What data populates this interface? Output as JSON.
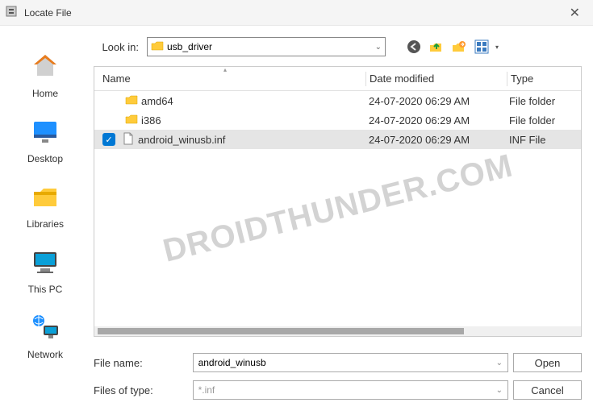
{
  "titlebar": {
    "title": "Locate File"
  },
  "lookin": {
    "label": "Look in:",
    "value": "usb_driver"
  },
  "sidebar": [
    {
      "label": "Home"
    },
    {
      "label": "Desktop"
    },
    {
      "label": "Libraries"
    },
    {
      "label": "This PC"
    },
    {
      "label": "Network"
    }
  ],
  "columns": {
    "name": "Name",
    "date": "Date modified",
    "type": "Type"
  },
  "rows": [
    {
      "name": "amd64",
      "date": "24-07-2020 06:29 AM",
      "type": "File folder",
      "icon": "folder",
      "selected": false
    },
    {
      "name": "i386",
      "date": "24-07-2020 06:29 AM",
      "type": "File folder",
      "icon": "folder",
      "selected": false
    },
    {
      "name": "android_winusb.inf",
      "date": "24-07-2020 06:29 AM",
      "type": "INF File",
      "icon": "file",
      "selected": true
    }
  ],
  "watermark": "DROIDTHUNDER.COM",
  "filename": {
    "label": "File name:",
    "value": "android_winusb"
  },
  "filetype": {
    "label": "Files of type:",
    "value": "*.inf"
  },
  "buttons": {
    "open": "Open",
    "cancel": "Cancel"
  }
}
